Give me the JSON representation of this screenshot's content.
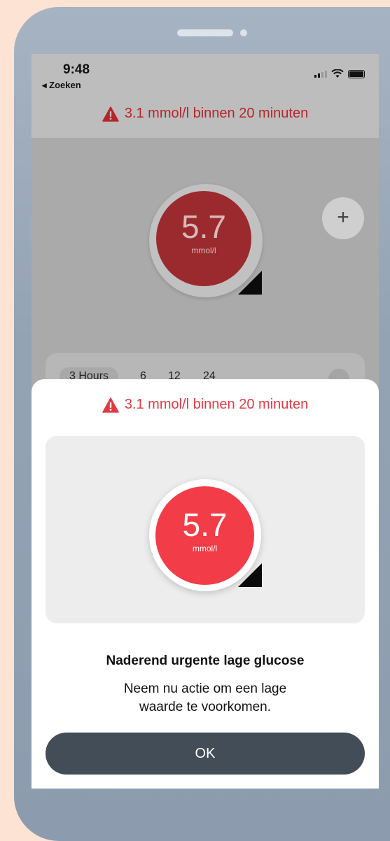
{
  "status_bar": {
    "time": "9:48",
    "back_label": "◂ Zoeken"
  },
  "top_alert": {
    "text": "3.1 mmol/l binnen 20 minuten"
  },
  "background": {
    "glucose_value": "5.7",
    "glucose_unit": "mmol/l",
    "add_button_label": "+",
    "time_ranges": [
      "3 Hours",
      "6",
      "12",
      "24"
    ]
  },
  "sheet": {
    "alert_text": "3.1 mmol/l binnen 20 minuten",
    "glucose_value": "5.7",
    "glucose_unit": "mmol/l",
    "title": "Naderend urgente lage glucose",
    "message": "Neem nu actie om een lage waarde te voorkomen.",
    "ok_label": "OK"
  },
  "colors": {
    "alert_red": "#e23a45",
    "gauge_red": "#f23c48",
    "button_dark": "#434d58"
  },
  "icons": [
    "warning-icon",
    "trend-arrow-icon",
    "signal-icon",
    "wifi-icon",
    "battery-icon",
    "plus-icon",
    "more-icon"
  ]
}
